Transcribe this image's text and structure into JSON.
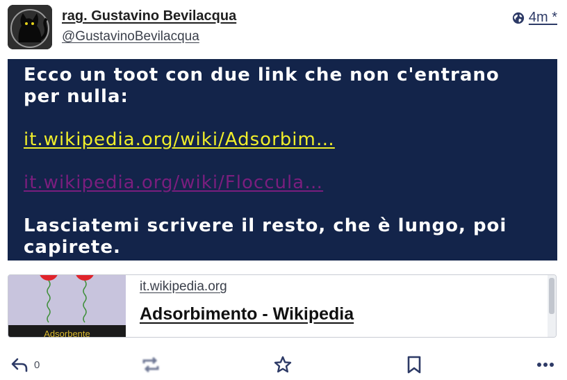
{
  "post": {
    "author": {
      "display_name": "rag. Gustavino Bevilacqua",
      "handle": "@GustavinoBevilacqua",
      "avatar_icon": "black-cat-icon"
    },
    "visibility_icon": "globe-icon",
    "time": "4m *",
    "content": {
      "intro": "Ecco un toot con due link che non c'entrano per nulla:",
      "link1": "it.wikipedia.org/wiki/Adsorbim…",
      "link2": "it.wikipedia.org/wiki/Floccula…",
      "outro": "Lasciatemi scrivere il resto, che è lungo, poi capirete."
    },
    "card": {
      "domain": "it.wikipedia.org",
      "title": "Adsorbimento - Wikipedia",
      "thumb_caption": "Adsorbente"
    },
    "actions": {
      "reply_icon": "reply-icon",
      "reply_count": "0",
      "boost_icon": "boost-icon",
      "favourite_icon": "star-icon",
      "bookmark_icon": "bookmark-icon",
      "more_icon": "more-icon"
    }
  },
  "colors": {
    "content_bg": "#13244a",
    "link_visited": "#7a1e7e",
    "link_unvisited": "#f0ee2a",
    "accent": "#2d3a66"
  }
}
